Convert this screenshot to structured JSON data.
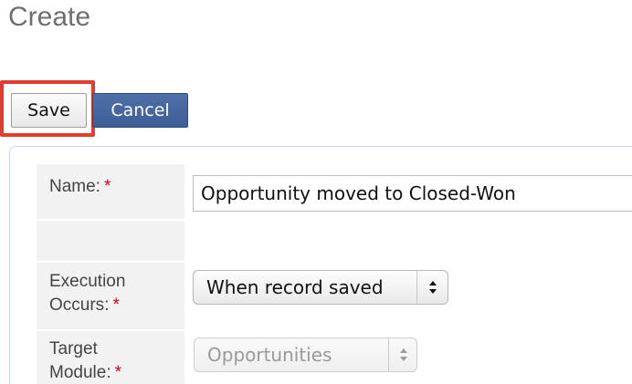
{
  "page": {
    "title": "Create"
  },
  "actions": {
    "save_label": "Save",
    "cancel_label": "Cancel",
    "highlight_color": "#e53b2f"
  },
  "form": {
    "required_marker": "*",
    "name": {
      "label": "Name:",
      "value": "Opportunity moved to Closed-Won"
    },
    "execution_occurs": {
      "label_line1": "Execution",
      "label_line2": "Occurs:",
      "selected": "When record saved"
    },
    "target_module": {
      "label_line1": "Target",
      "label_line2": "Module:",
      "selected": "Opportunities",
      "disabled": true
    }
  },
  "colors": {
    "cancel_button": "#3e5e98",
    "required": "#d0021b",
    "label_background": "#f2f2f2"
  },
  "icons": [
    "up-down-arrows-icon"
  ]
}
